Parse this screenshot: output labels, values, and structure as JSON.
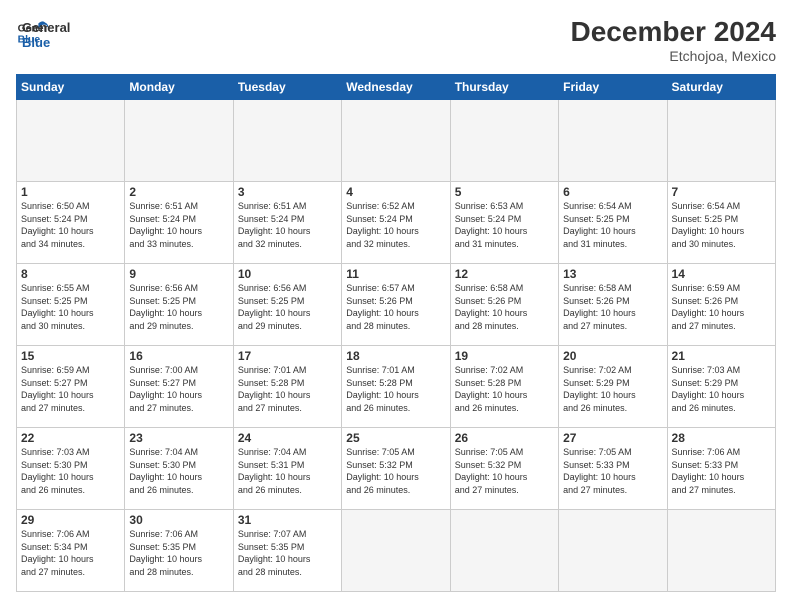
{
  "header": {
    "logo_line1": "General",
    "logo_line2": "Blue",
    "month_year": "December 2024",
    "location": "Etchojoa, Mexico"
  },
  "weekdays": [
    "Sunday",
    "Monday",
    "Tuesday",
    "Wednesday",
    "Thursday",
    "Friday",
    "Saturday"
  ],
  "days": [
    {
      "num": "",
      "info": ""
    },
    {
      "num": "",
      "info": ""
    },
    {
      "num": "",
      "info": ""
    },
    {
      "num": "",
      "info": ""
    },
    {
      "num": "",
      "info": ""
    },
    {
      "num": "",
      "info": ""
    },
    {
      "num": "",
      "info": ""
    },
    {
      "num": "1",
      "info": "Sunrise: 6:50 AM\nSunset: 5:24 PM\nDaylight: 10 hours\nand 34 minutes."
    },
    {
      "num": "2",
      "info": "Sunrise: 6:51 AM\nSunset: 5:24 PM\nDaylight: 10 hours\nand 33 minutes."
    },
    {
      "num": "3",
      "info": "Sunrise: 6:51 AM\nSunset: 5:24 PM\nDaylight: 10 hours\nand 32 minutes."
    },
    {
      "num": "4",
      "info": "Sunrise: 6:52 AM\nSunset: 5:24 PM\nDaylight: 10 hours\nand 32 minutes."
    },
    {
      "num": "5",
      "info": "Sunrise: 6:53 AM\nSunset: 5:24 PM\nDaylight: 10 hours\nand 31 minutes."
    },
    {
      "num": "6",
      "info": "Sunrise: 6:54 AM\nSunset: 5:25 PM\nDaylight: 10 hours\nand 31 minutes."
    },
    {
      "num": "7",
      "info": "Sunrise: 6:54 AM\nSunset: 5:25 PM\nDaylight: 10 hours\nand 30 minutes."
    },
    {
      "num": "8",
      "info": "Sunrise: 6:55 AM\nSunset: 5:25 PM\nDaylight: 10 hours\nand 30 minutes."
    },
    {
      "num": "9",
      "info": "Sunrise: 6:56 AM\nSunset: 5:25 PM\nDaylight: 10 hours\nand 29 minutes."
    },
    {
      "num": "10",
      "info": "Sunrise: 6:56 AM\nSunset: 5:25 PM\nDaylight: 10 hours\nand 29 minutes."
    },
    {
      "num": "11",
      "info": "Sunrise: 6:57 AM\nSunset: 5:26 PM\nDaylight: 10 hours\nand 28 minutes."
    },
    {
      "num": "12",
      "info": "Sunrise: 6:58 AM\nSunset: 5:26 PM\nDaylight: 10 hours\nand 28 minutes."
    },
    {
      "num": "13",
      "info": "Sunrise: 6:58 AM\nSunset: 5:26 PM\nDaylight: 10 hours\nand 27 minutes."
    },
    {
      "num": "14",
      "info": "Sunrise: 6:59 AM\nSunset: 5:26 PM\nDaylight: 10 hours\nand 27 minutes."
    },
    {
      "num": "15",
      "info": "Sunrise: 6:59 AM\nSunset: 5:27 PM\nDaylight: 10 hours\nand 27 minutes."
    },
    {
      "num": "16",
      "info": "Sunrise: 7:00 AM\nSunset: 5:27 PM\nDaylight: 10 hours\nand 27 minutes."
    },
    {
      "num": "17",
      "info": "Sunrise: 7:01 AM\nSunset: 5:28 PM\nDaylight: 10 hours\nand 27 minutes."
    },
    {
      "num": "18",
      "info": "Sunrise: 7:01 AM\nSunset: 5:28 PM\nDaylight: 10 hours\nand 26 minutes."
    },
    {
      "num": "19",
      "info": "Sunrise: 7:02 AM\nSunset: 5:28 PM\nDaylight: 10 hours\nand 26 minutes."
    },
    {
      "num": "20",
      "info": "Sunrise: 7:02 AM\nSunset: 5:29 PM\nDaylight: 10 hours\nand 26 minutes."
    },
    {
      "num": "21",
      "info": "Sunrise: 7:03 AM\nSunset: 5:29 PM\nDaylight: 10 hours\nand 26 minutes."
    },
    {
      "num": "22",
      "info": "Sunrise: 7:03 AM\nSunset: 5:30 PM\nDaylight: 10 hours\nand 26 minutes."
    },
    {
      "num": "23",
      "info": "Sunrise: 7:04 AM\nSunset: 5:30 PM\nDaylight: 10 hours\nand 26 minutes."
    },
    {
      "num": "24",
      "info": "Sunrise: 7:04 AM\nSunset: 5:31 PM\nDaylight: 10 hours\nand 26 minutes."
    },
    {
      "num": "25",
      "info": "Sunrise: 7:05 AM\nSunset: 5:32 PM\nDaylight: 10 hours\nand 26 minutes."
    },
    {
      "num": "26",
      "info": "Sunrise: 7:05 AM\nSunset: 5:32 PM\nDaylight: 10 hours\nand 27 minutes."
    },
    {
      "num": "27",
      "info": "Sunrise: 7:05 AM\nSunset: 5:33 PM\nDaylight: 10 hours\nand 27 minutes."
    },
    {
      "num": "28",
      "info": "Sunrise: 7:06 AM\nSunset: 5:33 PM\nDaylight: 10 hours\nand 27 minutes."
    },
    {
      "num": "29",
      "info": "Sunrise: 7:06 AM\nSunset: 5:34 PM\nDaylight: 10 hours\nand 27 minutes."
    },
    {
      "num": "30",
      "info": "Sunrise: 7:06 AM\nSunset: 5:35 PM\nDaylight: 10 hours\nand 28 minutes."
    },
    {
      "num": "31",
      "info": "Sunrise: 7:07 AM\nSunset: 5:35 PM\nDaylight: 10 hours\nand 28 minutes."
    },
    {
      "num": "",
      "info": ""
    },
    {
      "num": "",
      "info": ""
    },
    {
      "num": "",
      "info": ""
    },
    {
      "num": "",
      "info": ""
    },
    {
      "num": "",
      "info": ""
    }
  ]
}
